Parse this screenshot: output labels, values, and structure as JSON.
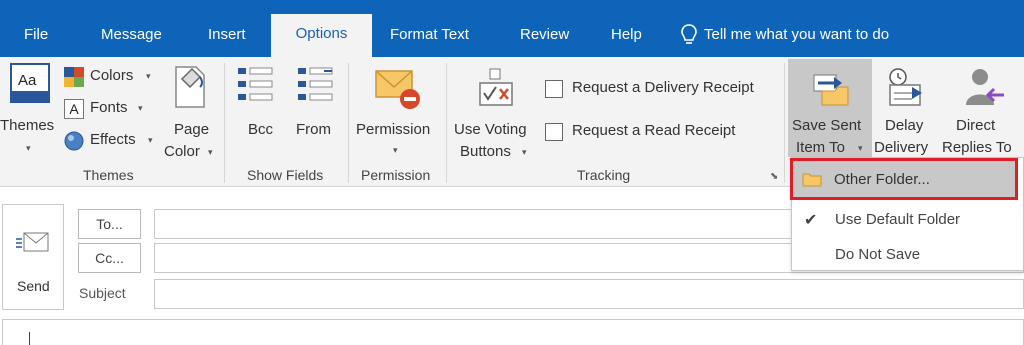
{
  "tabs": {
    "file": "File",
    "message": "Message",
    "insert": "Insert",
    "options": "Options",
    "format_text": "Format Text",
    "review": "Review",
    "help": "Help",
    "tell_me": "Tell me what you want to do"
  },
  "ribbon": {
    "themes": {
      "themes_label": "Themes",
      "colors_label": "Colors",
      "fonts_label": "Fonts",
      "effects_label": "Effects",
      "page_color_line1": "Page",
      "page_color_line2": "Color",
      "group_label": "Themes"
    },
    "show_fields": {
      "bcc_label": "Bcc",
      "from_label": "From",
      "group_label": "Show Fields"
    },
    "permission": {
      "permission_label": "Permission",
      "group_label": "Permission"
    },
    "tracking": {
      "use_voting_line1": "Use Voting",
      "use_voting_line2": "Buttons",
      "delivery_receipt_label": "Request a Delivery Receipt",
      "read_receipt_label": "Request a Read Receipt",
      "group_label": "Tracking"
    },
    "more_options": {
      "save_sent_line1": "Save Sent",
      "save_sent_line2": "Item To",
      "delay_line1": "Delay",
      "delay_line2": "Delivery",
      "direct_line1": "Direct",
      "direct_line2": "Replies To"
    }
  },
  "dropdown": {
    "other_folder": "Other Folder...",
    "use_default_folder": "Use Default Folder",
    "do_not_save": "Do Not Save"
  },
  "compose": {
    "send_label": "Send",
    "to_label": "To...",
    "cc_label": "Cc...",
    "subject_label": "Subject",
    "to_value": "",
    "cc_value": "",
    "subject_value": ""
  },
  "icons": {
    "themes": "themes-icon",
    "colors": "colors-icon",
    "fonts": "fonts-icon",
    "effects": "effects-icon",
    "page_color": "page-color-icon",
    "bcc": "bcc-icon",
    "from": "from-icon",
    "permission": "permission-icon",
    "use_voting": "voting-buttons-icon",
    "save_sent": "save-sent-items-icon",
    "delay": "delay-delivery-icon",
    "direct": "direct-replies-icon",
    "folder": "folder-icon",
    "check": "checkmark-icon",
    "send": "send-icon",
    "lightbulb": "lightbulb-icon",
    "launcher": "dialog-launcher-icon"
  },
  "colors": {
    "tab_bar": "#0e64b8",
    "ribbon_bg": "#f3f3f3",
    "accent_blue": "#1a60b8",
    "highlight_border": "#e01e26",
    "highlight_fill": "#c8c8c8"
  }
}
